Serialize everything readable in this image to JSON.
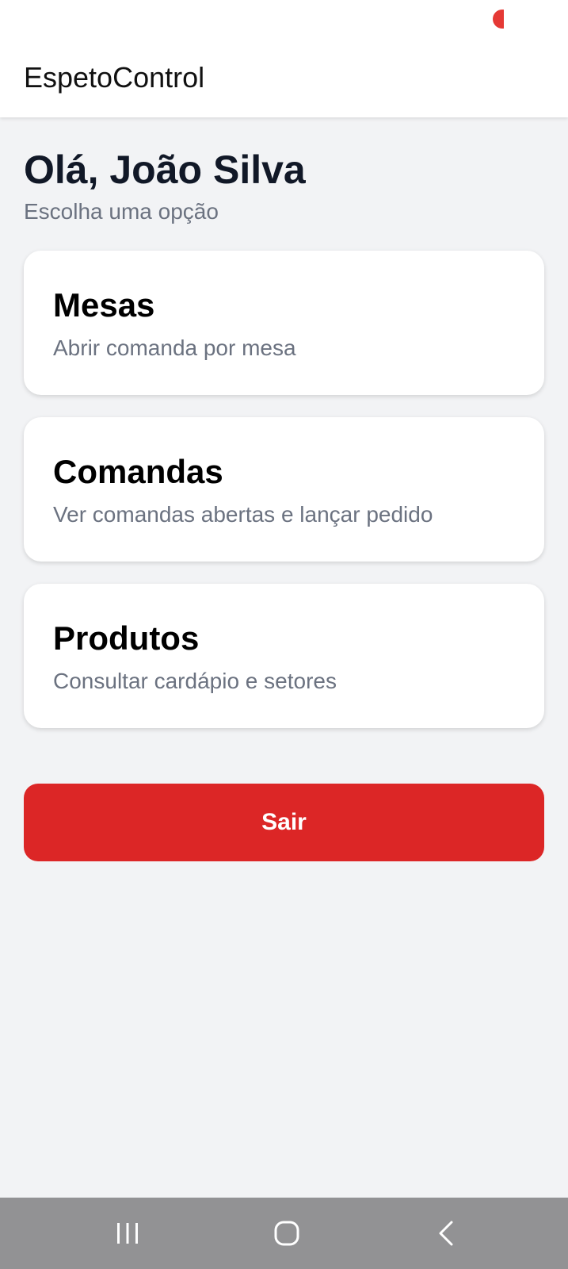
{
  "app_bar": {
    "title": "EspetoControl",
    "indicator_color": "#e53935"
  },
  "header": {
    "greeting": "Olá, João Silva",
    "subtitle": "Escolha uma opção"
  },
  "menu": {
    "items": [
      {
        "title": "Mesas",
        "description": "Abrir comanda por mesa"
      },
      {
        "title": "Comandas",
        "description": "Ver comandas abertas e lançar pedido"
      },
      {
        "title": "Produtos",
        "description": "Consultar cardápio e setores"
      }
    ]
  },
  "logout": {
    "label": "Sair",
    "color": "#dc2626"
  },
  "navigation_bar": {
    "buttons": [
      "recent-apps-icon",
      "home-icon",
      "back-icon"
    ],
    "background": "#929294"
  }
}
